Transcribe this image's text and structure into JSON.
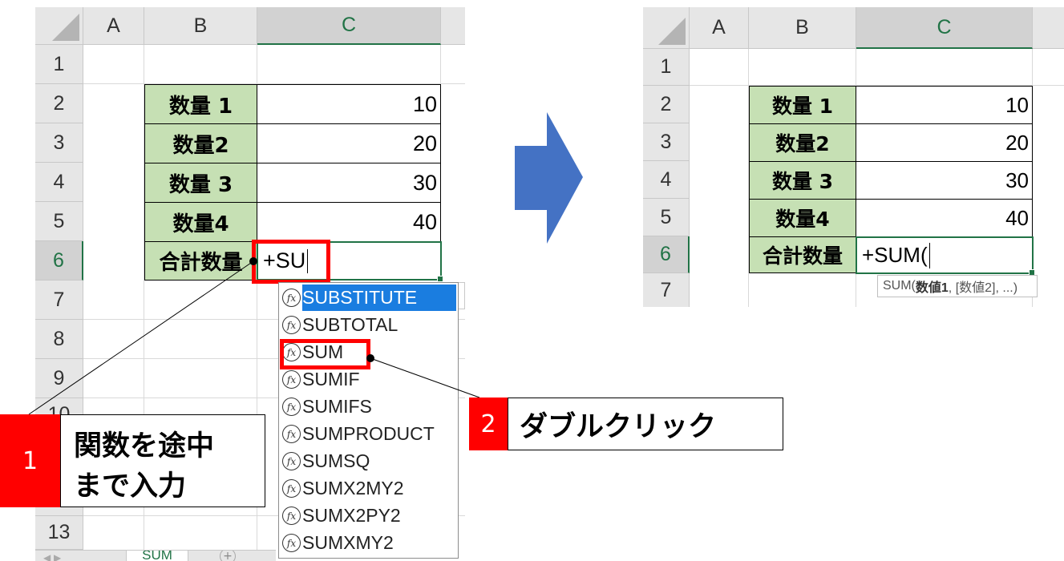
{
  "left_sheet": {
    "columns": [
      "A",
      "B",
      "C"
    ],
    "rows": [
      "1",
      "2",
      "3",
      "4",
      "5",
      "6",
      "7",
      "8",
      "9",
      "10",
      "13"
    ],
    "labels": [
      "数量 1",
      "数量2",
      "数量 3",
      "数量4",
      "合計数量"
    ],
    "values": [
      "10",
      "20",
      "30",
      "40"
    ],
    "formula_input": "+SU",
    "autocomplete": [
      "SUBSTITUTE",
      "SUBTOTAL",
      "SUM",
      "SUMIF",
      "SUMIFS",
      "SUMPRODUCT",
      "SUMSQ",
      "SUMX2MY2",
      "SUMX2PY2",
      "SUMXMY2"
    ],
    "fx_glyph": "fx",
    "sheet_tab": "SUM",
    "add_sheet_glyph": "+"
  },
  "right_sheet": {
    "columns": [
      "A",
      "B",
      "C"
    ],
    "rows": [
      "1",
      "2",
      "3",
      "4",
      "5",
      "6",
      "7"
    ],
    "labels": [
      "数量 1",
      "数量2",
      "数量 3",
      "数量4",
      "合計数量"
    ],
    "values": [
      "10",
      "20",
      "30",
      "40"
    ],
    "formula_input": "+SUM(",
    "tooltip_func": "SUM(",
    "tooltip_arg1": "数値1",
    "tooltip_rest": ", [数値2], ...)"
  },
  "steps": [
    {
      "number": "1",
      "text_line1": "関数を途中",
      "text_line2": "まで入力"
    },
    {
      "number": "2",
      "text": "ダブルクリック"
    }
  ],
  "colors": {
    "label_fill": "#c6e0b4",
    "excel_green": "#217346",
    "highlight_red": "#ff0000",
    "arrow_blue": "#4472c4",
    "selection_blue": "#1a7de0"
  }
}
